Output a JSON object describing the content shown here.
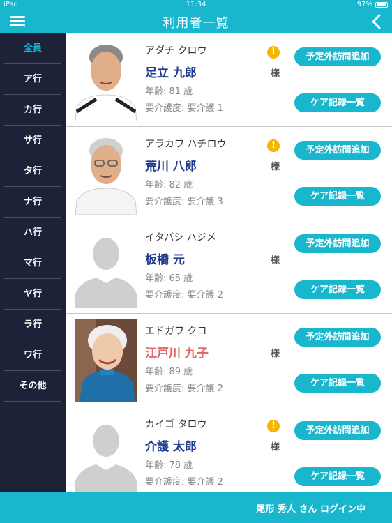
{
  "status_bar": {
    "device": "iPad",
    "time": "11:34",
    "battery": "97%"
  },
  "nav": {
    "title": "利用者一覧"
  },
  "sidebar": {
    "items": [
      {
        "label": "全員",
        "active": true
      },
      {
        "label": "ア行"
      },
      {
        "label": "カ行"
      },
      {
        "label": "サ行"
      },
      {
        "label": "タ行"
      },
      {
        "label": "ナ行"
      },
      {
        "label": "ハ行"
      },
      {
        "label": "マ行"
      },
      {
        "label": "ヤ行"
      },
      {
        "label": "ラ行"
      },
      {
        "label": "ワ行"
      },
      {
        "label": "その他"
      }
    ]
  },
  "users": [
    {
      "kana": "アダチ クロウ",
      "name": "足立 九郎",
      "age": "年齢:  81 歳",
      "care": "要介護度:  要介護 1",
      "alert": true,
      "photo": "photo-man-1",
      "red": false
    },
    {
      "kana": "アラカワ ハチロウ",
      "name": "荒川 八郎",
      "age": "年齢:  82 歳",
      "care": "要介護度:  要介護 3",
      "alert": true,
      "photo": "photo-man-2",
      "red": false
    },
    {
      "kana": "イタバシ ハジメ",
      "name": "板橋 元",
      "age": "年齢:  65 歳",
      "care": "要介護度:  要介護 2",
      "alert": false,
      "photo": "placeholder",
      "red": false
    },
    {
      "kana": "エドガワ クコ",
      "name": "江戸川 九子",
      "age": "年齢:  89 歳",
      "care": "要介護度:  要介護 2",
      "alert": false,
      "photo": "photo-woman",
      "red": true
    },
    {
      "kana": "カイゴ タロウ",
      "name": "介護 太郎",
      "age": "年齢:  78 歳",
      "care": "要介護度:  要介護 2",
      "alert": true,
      "photo": "placeholder",
      "red": false
    }
  ],
  "labels": {
    "sama": "様",
    "alert_mark": "!",
    "unscheduled_visit": "予定外訪問追加",
    "care_records": "ケア記録一覧"
  },
  "footer": {
    "login_text": "尾形 秀人 さん ログイン中"
  },
  "colors": {
    "accent": "#19b7ce",
    "sidebar": "#1e2238",
    "name": "#1f3b8e",
    "name_alert": "#e06464",
    "alert_badge": "#f7b500"
  }
}
